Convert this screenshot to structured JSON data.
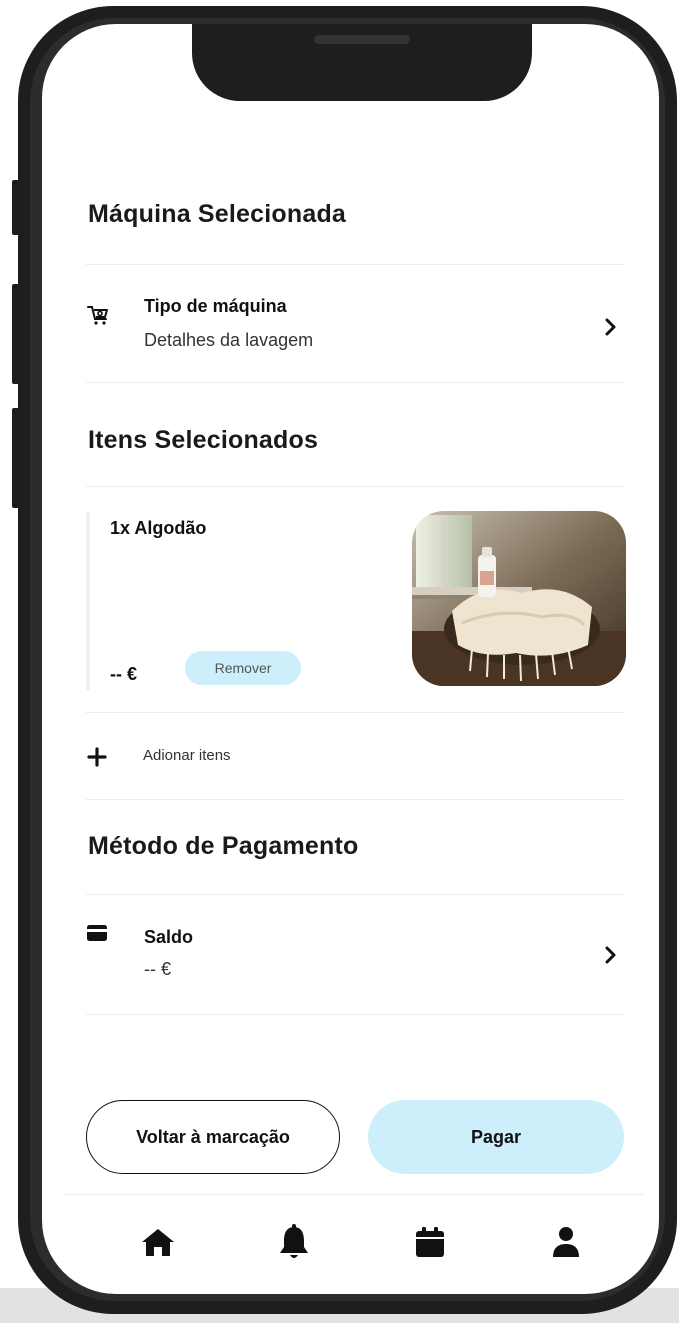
{
  "machine_section": {
    "title": "Máquina Selecionada",
    "row": {
      "icon": "washing-machine-icon",
      "title": "Tipo de máquina",
      "subtitle": "Detalhes da lavagem"
    }
  },
  "items_section": {
    "title": "Itens Selecionados",
    "items": [
      {
        "name": "1x  Algodão",
        "price": "-- €",
        "remove_label": "Remover",
        "image": "laundry-basket-photo"
      }
    ],
    "add_label": "Adionar itens"
  },
  "payment_section": {
    "title": "Método de Pagamento",
    "row": {
      "icon": "credit-card-icon",
      "title": "Saldo",
      "subtitle": "-- €"
    }
  },
  "actions": {
    "back_label": "Voltar à marcação",
    "pay_label": "Pagar"
  },
  "tabbar": [
    "home-icon",
    "bell-icon",
    "calendar-icon",
    "user-icon"
  ],
  "colors": {
    "accent": "#cdeefb",
    "text": "#111111",
    "divider": "#ececec",
    "frame": "#1e1e20"
  }
}
